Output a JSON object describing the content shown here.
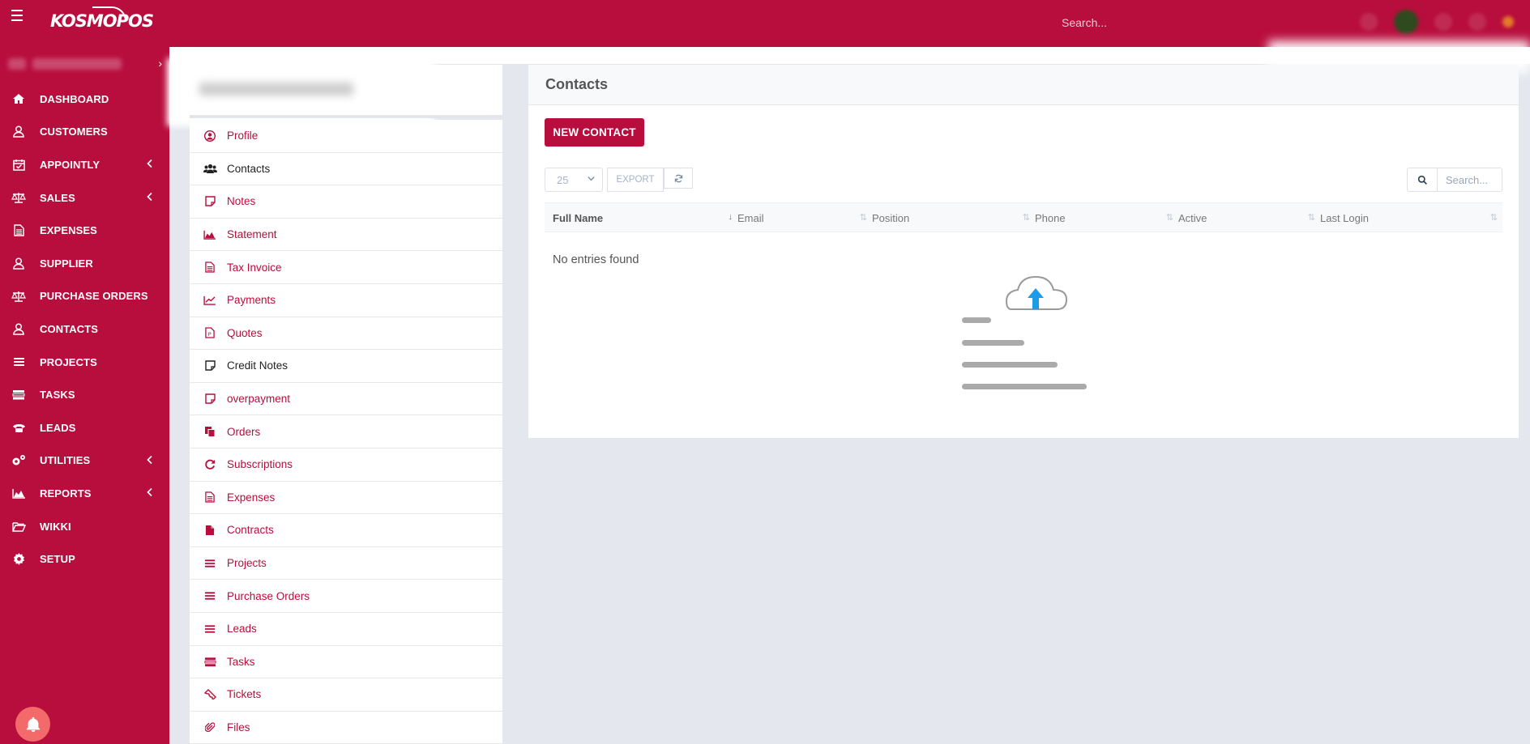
{
  "topbar": {
    "logo_text": "KOSMOPOS",
    "search_placeholder": "Search..."
  },
  "sidebar": {
    "items": [
      {
        "label": "DASHBOARD",
        "icon": "home-icon",
        "has_arrow": false
      },
      {
        "label": "CUSTOMERS",
        "icon": "user-icon",
        "has_arrow": false
      },
      {
        "label": "APPOINTLY",
        "icon": "calendar-check-icon",
        "has_arrow": true
      },
      {
        "label": "SALES",
        "icon": "balance-scale-icon",
        "has_arrow": true
      },
      {
        "label": "EXPENSES",
        "icon": "file-text-icon",
        "has_arrow": false
      },
      {
        "label": "SUPPLIER",
        "icon": "user-icon",
        "has_arrow": false
      },
      {
        "label": "PURCHASE ORDERS",
        "icon": "balance-scale-icon",
        "has_arrow": false
      },
      {
        "label": "CONTACTS",
        "icon": "user-icon",
        "has_arrow": false
      },
      {
        "label": "PROJECTS",
        "icon": "bars-icon",
        "has_arrow": false
      },
      {
        "label": "TASKS",
        "icon": "tasks-icon",
        "has_arrow": false
      },
      {
        "label": "LEADS",
        "icon": "phone-icon",
        "has_arrow": false
      },
      {
        "label": "UTILITIES",
        "icon": "cogs-icon",
        "has_arrow": true
      },
      {
        "label": "REPORTS",
        "icon": "area-chart-icon",
        "has_arrow": true
      },
      {
        "label": "WIKKI",
        "icon": "folder-open-icon",
        "has_arrow": false
      },
      {
        "label": "SETUP",
        "icon": "gear-icon",
        "has_arrow": false
      }
    ]
  },
  "subnav": {
    "items": [
      {
        "label": "Profile",
        "icon": "user-circle-icon",
        "active": false
      },
      {
        "label": "Contacts",
        "icon": "users-icon",
        "active": true
      },
      {
        "label": "Notes",
        "icon": "sticky-note-icon",
        "active": false
      },
      {
        "label": "Statement",
        "icon": "area-chart-icon",
        "active": false
      },
      {
        "label": "Tax Invoice",
        "icon": "file-text-icon",
        "active": false
      },
      {
        "label": "Payments",
        "icon": "line-chart-icon",
        "active": false
      },
      {
        "label": "Quotes",
        "icon": "file-quote-icon",
        "active": false
      },
      {
        "label": "Credit Notes",
        "icon": "sticky-note-icon",
        "active": true
      },
      {
        "label": "overpayment",
        "icon": "sticky-note-icon",
        "active": false
      },
      {
        "label": "Orders",
        "icon": "copy-icon",
        "active": false
      },
      {
        "label": "Subscriptions",
        "icon": "refresh-icon",
        "active": false
      },
      {
        "label": "Expenses",
        "icon": "file-text-icon",
        "active": false
      },
      {
        "label": "Contracts",
        "icon": "file-icon",
        "active": false
      },
      {
        "label": "Projects",
        "icon": "bars-icon",
        "active": false
      },
      {
        "label": "Purchase Orders",
        "icon": "bars-icon",
        "active": false
      },
      {
        "label": "Leads",
        "icon": "bars-icon",
        "active": false
      },
      {
        "label": "Tasks",
        "icon": "tasks-icon",
        "active": false
      },
      {
        "label": "Tickets",
        "icon": "ticket-icon",
        "active": false
      },
      {
        "label": "Files",
        "icon": "paperclip-icon",
        "active": false
      }
    ]
  },
  "main": {
    "title": "Contacts",
    "new_button": "NEW CONTACT",
    "page_length": "25",
    "export_label": "EXPORT",
    "search_placeholder": "Search...",
    "columns": [
      "Full Name",
      "Email",
      "Position",
      "Phone",
      "Active",
      "Last Login"
    ],
    "empty_text": "No entries found"
  },
  "colors": {
    "brand": "#b80e3d",
    "bell": "#f36a6a",
    "upload_arrow": "#1e9be6"
  }
}
